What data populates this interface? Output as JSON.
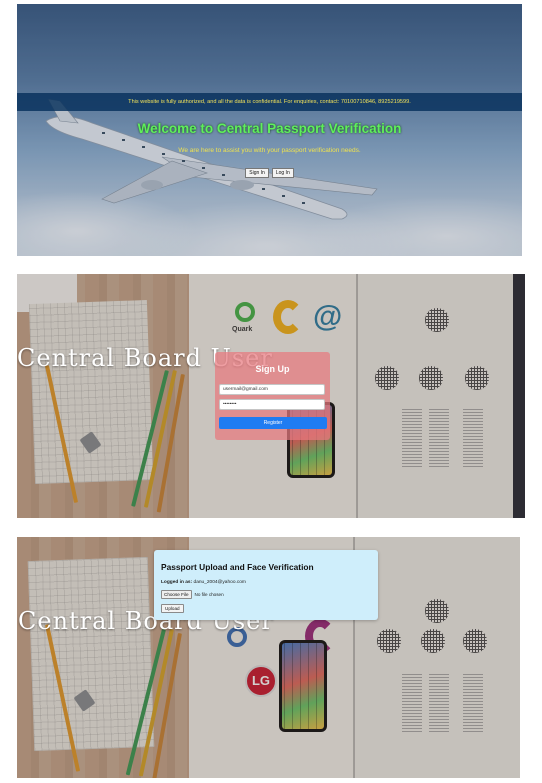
{
  "landing": {
    "notice": "This website is fully authorized, and all the data is confidential. For enquiries, contact: 70100710846, 8925219599.",
    "welcome": "Welcome to Central Passport Verification",
    "tagline": "We are here to assist you with your passport verification needs.",
    "signin_label": "Sign In",
    "login_label": "Log In"
  },
  "signup_page": {
    "board_title": "Central Board User",
    "form_title": "Sign Up",
    "email_value": "usermail@gmail.com",
    "password_value": "••••••••",
    "register_label": "Register",
    "logos": {
      "quark": "Quark"
    }
  },
  "upload_page": {
    "board_title": "Central Board User",
    "card_title": "Passport Upload and Face Verification",
    "logged_in_label": "Logged in as:",
    "logged_in_user": "danu_2004@yahoo.com",
    "choose_file_label": "Choose File",
    "no_file_text": "No file chosen",
    "upload_label": "Upload",
    "logos": {
      "lg": "LG"
    }
  },
  "colors": {
    "info_bar": "#06305c",
    "welcome_green": "#5ff05b",
    "tagline_yellow": "#f0e34e",
    "signup_card": "#e8787e",
    "register_blue": "#1f7cf2",
    "upload_card": "#cfeefb"
  }
}
